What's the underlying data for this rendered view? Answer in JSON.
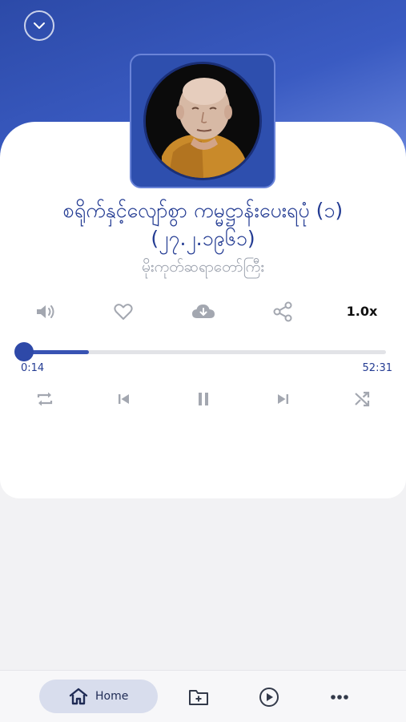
{
  "player": {
    "title_line1": "စရိုက်နှင့်လျော်စွာ ကမ္မဋ္ဌာန်းပေးရပုံ (၁)",
    "title_line2": "(၂၇.၂.၁၉၆၁)",
    "artist": "မိုးကုတ်ဆရာတော်ကြီး",
    "speed": "1.0x",
    "elapsed": "0:14",
    "duration": "52:31",
    "progress_fraction": 0.18
  },
  "nav": {
    "home_label": "Home"
  },
  "icons": {
    "collapse": "chevron-down-icon",
    "volume": "volume-icon",
    "favorite": "heart-icon",
    "download": "cloud-download-icon",
    "share": "share-icon",
    "repeat": "repeat-icon",
    "previous": "skip-previous-icon",
    "pause": "pause-icon",
    "next": "skip-next-icon",
    "shuffle": "shuffle-icon",
    "home": "home-icon",
    "library": "folder-add-icon",
    "play": "play-circle-icon",
    "more": "more-icon"
  },
  "colors": {
    "primary": "#2e49a8",
    "title": "#243c93",
    "icon_gray": "#a3a7b0",
    "nav_pill": "#d8dded"
  }
}
